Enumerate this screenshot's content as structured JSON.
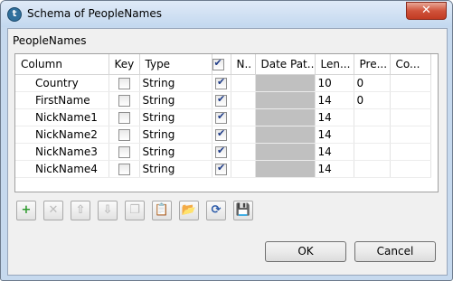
{
  "window": {
    "title": "Schema of PeopleNames",
    "close_glyph": "✕",
    "app_icon_glyph": "t"
  },
  "group": {
    "label": "PeopleNames"
  },
  "table": {
    "headers": {
      "column": "Column",
      "key": "Key",
      "type": "Type",
      "nullable": "N..",
      "date_pattern": "Date Pat...",
      "length": "Len...",
      "precision": "Pre...",
      "comment": "Co..."
    },
    "rows": [
      {
        "column": "Country",
        "key": false,
        "type": "String",
        "nullable": true,
        "length": "10",
        "precision": "0"
      },
      {
        "column": "FirstName",
        "key": false,
        "type": "String",
        "nullable": true,
        "length": "14",
        "precision": "0"
      },
      {
        "column": "NickName1",
        "key": false,
        "type": "String",
        "nullable": true,
        "length": "14",
        "precision": ""
      },
      {
        "column": "NickName2",
        "key": false,
        "type": "String",
        "nullable": true,
        "length": "14",
        "precision": ""
      },
      {
        "column": "NickName3",
        "key": false,
        "type": "String",
        "nullable": true,
        "length": "14",
        "precision": ""
      },
      {
        "column": "NickName4",
        "key": false,
        "type": "String",
        "nullable": true,
        "length": "14",
        "precision": ""
      }
    ]
  },
  "toolbar": {
    "buttons": [
      {
        "name": "add-icon",
        "glyph": "+",
        "enabled": true
      },
      {
        "name": "remove-icon",
        "glyph": "✕",
        "enabled": false
      },
      {
        "name": "move-up-icon",
        "glyph": "⇧",
        "enabled": false
      },
      {
        "name": "move-down-icon",
        "glyph": "⇩",
        "enabled": false
      },
      {
        "name": "copy-icon",
        "glyph": "❐",
        "enabled": false
      },
      {
        "name": "paste-icon",
        "glyph": "📋",
        "enabled": false
      },
      {
        "name": "import-icon",
        "glyph": "📂",
        "enabled": true
      },
      {
        "name": "export-icon",
        "glyph": "⟳",
        "enabled": true
      },
      {
        "name": "save-icon",
        "glyph": "💾",
        "enabled": true
      }
    ]
  },
  "buttons": {
    "ok": "OK",
    "cancel": "Cancel"
  },
  "colors": {
    "accent": "#1f3c88",
    "close": "#c23b22",
    "date_cell": "#c0c0c0"
  }
}
